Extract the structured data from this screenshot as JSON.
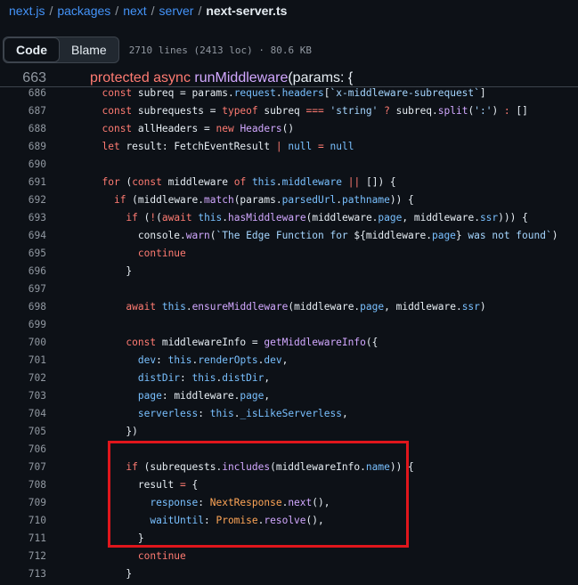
{
  "breadcrumb": {
    "repo": "next.js",
    "folders": [
      "packages",
      "next",
      "server"
    ],
    "file": "next-server.ts",
    "separator": "/"
  },
  "toolbar": {
    "code_label": "Code",
    "blame_label": "Blame",
    "meta": "2710 lines (2413 loc) · 80.6 KB"
  },
  "sticky_line": {
    "num": "663",
    "tokens": [
      {
        "t": "protected ",
        "c": "kw"
      },
      {
        "t": "async ",
        "c": "kw"
      },
      {
        "t": "runMiddleware",
        "c": "fn"
      },
      {
        "t": "(params: {",
        "c": ""
      }
    ]
  },
  "lines": [
    {
      "num": "686",
      "tokens": [
        {
          "t": "  "
        },
        {
          "t": "const",
          "c": "kw"
        },
        {
          "t": " subreq = params."
        },
        {
          "t": "request",
          "c": "prop"
        },
        {
          "t": "."
        },
        {
          "t": "headers",
          "c": "prop"
        },
        {
          "t": "["
        },
        {
          "t": "`x-middleware-subrequest`",
          "c": "str"
        },
        {
          "t": "]"
        }
      ]
    },
    {
      "num": "687",
      "tokens": [
        {
          "t": "  "
        },
        {
          "t": "const",
          "c": "kw"
        },
        {
          "t": " subrequests = "
        },
        {
          "t": "typeof",
          "c": "kw"
        },
        {
          "t": " subreq "
        },
        {
          "t": "===",
          "c": "kw"
        },
        {
          "t": " "
        },
        {
          "t": "'string'",
          "c": "str"
        },
        {
          "t": " "
        },
        {
          "t": "?",
          "c": "kw"
        },
        {
          "t": " subreq."
        },
        {
          "t": "split",
          "c": "fn"
        },
        {
          "t": "("
        },
        {
          "t": "':'",
          "c": "str"
        },
        {
          "t": ") "
        },
        {
          "t": ":",
          "c": "kw"
        },
        {
          "t": " []"
        }
      ]
    },
    {
      "num": "688",
      "tokens": [
        {
          "t": "  "
        },
        {
          "t": "const",
          "c": "kw"
        },
        {
          "t": " allHeaders = "
        },
        {
          "t": "new",
          "c": "kw"
        },
        {
          "t": " "
        },
        {
          "t": "Headers",
          "c": "fn"
        },
        {
          "t": "()"
        }
      ]
    },
    {
      "num": "689",
      "tokens": [
        {
          "t": "  "
        },
        {
          "t": "let",
          "c": "kw"
        },
        {
          "t": " result: FetchEventResult "
        },
        {
          "t": "|",
          "c": "kw"
        },
        {
          "t": " "
        },
        {
          "t": "null",
          "c": "prop"
        },
        {
          "t": " "
        },
        {
          "t": "=",
          "c": "kw"
        },
        {
          "t": " "
        },
        {
          "t": "null",
          "c": "prop"
        }
      ]
    },
    {
      "num": "690",
      "tokens": []
    },
    {
      "num": "691",
      "tokens": [
        {
          "t": "  "
        },
        {
          "t": "for",
          "c": "kw"
        },
        {
          "t": " ("
        },
        {
          "t": "const",
          "c": "kw"
        },
        {
          "t": " middleware "
        },
        {
          "t": "of",
          "c": "kw"
        },
        {
          "t": " "
        },
        {
          "t": "this",
          "c": "prop"
        },
        {
          "t": "."
        },
        {
          "t": "middleware",
          "c": "prop"
        },
        {
          "t": " "
        },
        {
          "t": "||",
          "c": "kw"
        },
        {
          "t": " []) {"
        }
      ]
    },
    {
      "num": "692",
      "tokens": [
        {
          "t": "    "
        },
        {
          "t": "if",
          "c": "kw"
        },
        {
          "t": " (middleware."
        },
        {
          "t": "match",
          "c": "fn"
        },
        {
          "t": "(params."
        },
        {
          "t": "parsedUrl",
          "c": "prop"
        },
        {
          "t": "."
        },
        {
          "t": "pathname",
          "c": "prop"
        },
        {
          "t": ")) {"
        }
      ]
    },
    {
      "num": "693",
      "tokens": [
        {
          "t": "      "
        },
        {
          "t": "if",
          "c": "kw"
        },
        {
          "t": " ("
        },
        {
          "t": "!",
          "c": "kw"
        },
        {
          "t": "("
        },
        {
          "t": "await",
          "c": "kw"
        },
        {
          "t": " "
        },
        {
          "t": "this",
          "c": "prop"
        },
        {
          "t": "."
        },
        {
          "t": "hasMiddleware",
          "c": "fn"
        },
        {
          "t": "(middleware."
        },
        {
          "t": "page",
          "c": "prop"
        },
        {
          "t": ", middleware."
        },
        {
          "t": "ssr",
          "c": "prop"
        },
        {
          "t": "))) {"
        }
      ]
    },
    {
      "num": "694",
      "tokens": [
        {
          "t": "        console."
        },
        {
          "t": "warn",
          "c": "fn"
        },
        {
          "t": "("
        },
        {
          "t": "`The Edge Function for ",
          "c": "str"
        },
        {
          "t": "${middleware."
        },
        {
          "t": "page",
          "c": "prop"
        },
        {
          "t": "}"
        },
        {
          "t": " was not found`",
          "c": "str"
        },
        {
          "t": ")"
        }
      ]
    },
    {
      "num": "695",
      "tokens": [
        {
          "t": "        "
        },
        {
          "t": "continue",
          "c": "kw"
        }
      ]
    },
    {
      "num": "696",
      "tokens": [
        {
          "t": "      }"
        }
      ]
    },
    {
      "num": "697",
      "tokens": []
    },
    {
      "num": "698",
      "tokens": [
        {
          "t": "      "
        },
        {
          "t": "await",
          "c": "kw"
        },
        {
          "t": " "
        },
        {
          "t": "this",
          "c": "prop"
        },
        {
          "t": "."
        },
        {
          "t": "ensureMiddleware",
          "c": "fn"
        },
        {
          "t": "(middleware."
        },
        {
          "t": "page",
          "c": "prop"
        },
        {
          "t": ", middleware."
        },
        {
          "t": "ssr",
          "c": "prop"
        },
        {
          "t": ")"
        }
      ]
    },
    {
      "num": "699",
      "tokens": []
    },
    {
      "num": "700",
      "tokens": [
        {
          "t": "      "
        },
        {
          "t": "const",
          "c": "kw"
        },
        {
          "t": " middlewareInfo = "
        },
        {
          "t": "getMiddlewareInfo",
          "c": "fn"
        },
        {
          "t": "({"
        }
      ]
    },
    {
      "num": "701",
      "tokens": [
        {
          "t": "        "
        },
        {
          "t": "dev",
          "c": "prop"
        },
        {
          "t": ": "
        },
        {
          "t": "this",
          "c": "prop"
        },
        {
          "t": "."
        },
        {
          "t": "renderOpts",
          "c": "prop"
        },
        {
          "t": "."
        },
        {
          "t": "dev",
          "c": "prop"
        },
        {
          "t": ","
        }
      ]
    },
    {
      "num": "702",
      "tokens": [
        {
          "t": "        "
        },
        {
          "t": "distDir",
          "c": "prop"
        },
        {
          "t": ": "
        },
        {
          "t": "this",
          "c": "prop"
        },
        {
          "t": "."
        },
        {
          "t": "distDir",
          "c": "prop"
        },
        {
          "t": ","
        }
      ]
    },
    {
      "num": "703",
      "tokens": [
        {
          "t": "        "
        },
        {
          "t": "page",
          "c": "prop"
        },
        {
          "t": ": middleware."
        },
        {
          "t": "page",
          "c": "prop"
        },
        {
          "t": ","
        }
      ]
    },
    {
      "num": "704",
      "tokens": [
        {
          "t": "        "
        },
        {
          "t": "serverless",
          "c": "prop"
        },
        {
          "t": ": "
        },
        {
          "t": "this",
          "c": "prop"
        },
        {
          "t": "."
        },
        {
          "t": "_isLikeServerless",
          "c": "prop"
        },
        {
          "t": ","
        }
      ]
    },
    {
      "num": "705",
      "tokens": [
        {
          "t": "      })"
        }
      ]
    },
    {
      "num": "706",
      "tokens": []
    },
    {
      "num": "707",
      "tokens": [
        {
          "t": "      "
        },
        {
          "t": "if",
          "c": "kw"
        },
        {
          "t": " (subrequests."
        },
        {
          "t": "includes",
          "c": "fn"
        },
        {
          "t": "(middlewareInfo."
        },
        {
          "t": "name",
          "c": "prop"
        },
        {
          "t": ")) {"
        }
      ]
    },
    {
      "num": "708",
      "tokens": [
        {
          "t": "        result "
        },
        {
          "t": "=",
          "c": "kw"
        },
        {
          "t": " {"
        }
      ]
    },
    {
      "num": "709",
      "tokens": [
        {
          "t": "          "
        },
        {
          "t": "response",
          "c": "prop"
        },
        {
          "t": ": "
        },
        {
          "t": "NextResponse",
          "c": "ty"
        },
        {
          "t": "."
        },
        {
          "t": "next",
          "c": "fn"
        },
        {
          "t": "(),"
        }
      ]
    },
    {
      "num": "710",
      "tokens": [
        {
          "t": "          "
        },
        {
          "t": "waitUntil",
          "c": "prop"
        },
        {
          "t": ": "
        },
        {
          "t": "Promise",
          "c": "ty"
        },
        {
          "t": "."
        },
        {
          "t": "resolve",
          "c": "fn"
        },
        {
          "t": "(),"
        }
      ]
    },
    {
      "num": "711",
      "tokens": [
        {
          "t": "        }"
        }
      ]
    },
    {
      "num": "712",
      "tokens": [
        {
          "t": "        "
        },
        {
          "t": "continue",
          "c": "kw"
        }
      ]
    },
    {
      "num": "713",
      "tokens": [
        {
          "t": "      }"
        }
      ]
    }
  ],
  "colors": {
    "background": "#0d1117",
    "link": "#4493f8",
    "keyword": "#ff7b72",
    "function": "#d2a8ff",
    "string": "#a5d6ff",
    "property": "#79c0ff",
    "type": "#ffa657",
    "annotation_box": "#e0161c"
  }
}
